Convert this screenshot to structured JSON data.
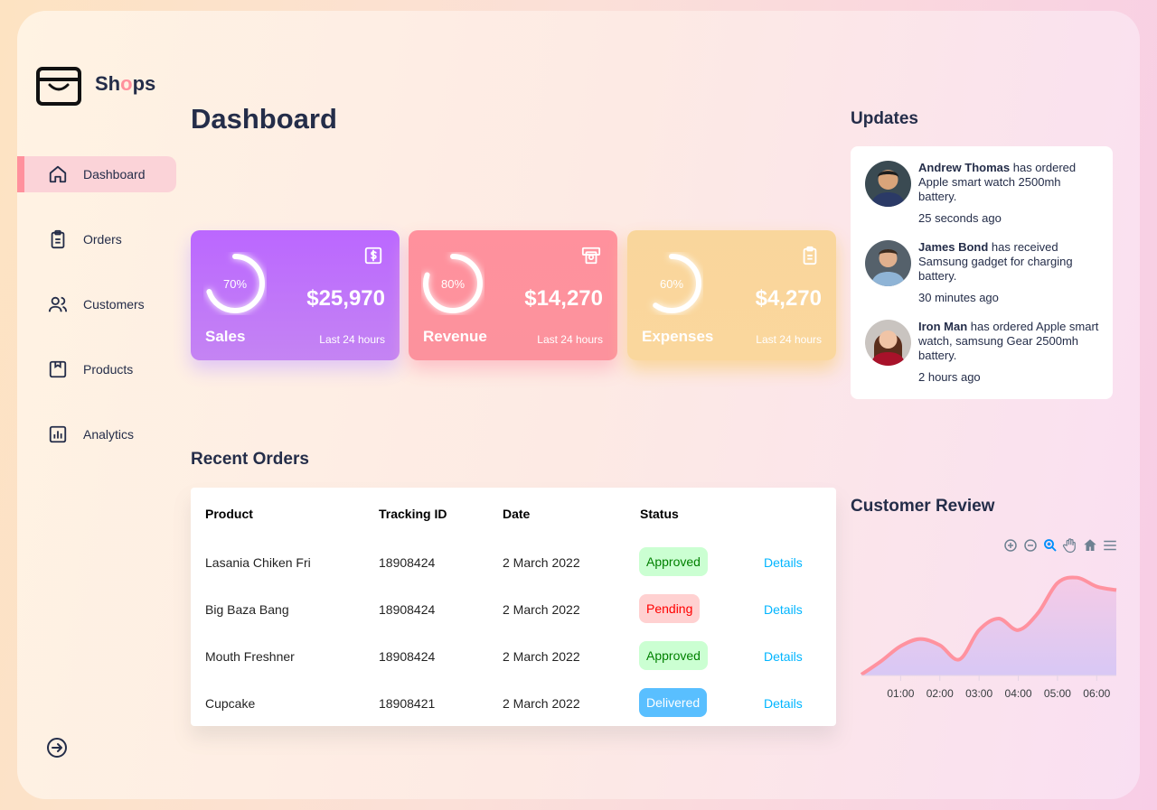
{
  "brand": {
    "name_pre": "Sh",
    "name_o": "o",
    "name_post": "ps"
  },
  "sidebar": {
    "items": [
      {
        "label": "Dashboard",
        "icon": "home-icon",
        "active": true
      },
      {
        "label": "Orders",
        "icon": "clipboard-icon"
      },
      {
        "label": "Customers",
        "icon": "users-icon"
      },
      {
        "label": "Products",
        "icon": "package-icon"
      },
      {
        "label": "Analytics",
        "icon": "bar-chart-icon"
      }
    ],
    "signout_icon": "sign-out-icon"
  },
  "main": {
    "title": "Dashboard"
  },
  "cards": [
    {
      "title": "Sales",
      "value": "$25,970",
      "percent": "70%",
      "fraction": 0.7,
      "period": "Last 24 hours",
      "icon": "dollar-icon",
      "color": "#bb67ff"
    },
    {
      "title": "Revenue",
      "value": "$14,270",
      "percent": "80%",
      "fraction": 0.8,
      "period": "Last 24 hours",
      "icon": "money-icon",
      "color": "#ff919d"
    },
    {
      "title": "Expenses",
      "value": "$4,270",
      "percent": "60%",
      "fraction": 0.6,
      "period": "Last 24 hours",
      "icon": "clipboard-icon",
      "color": "#fad79d"
    }
  ],
  "orders": {
    "title": "Recent Orders",
    "headers": [
      "Product",
      "Tracking ID",
      "Date",
      "Status"
    ],
    "rows": [
      {
        "product": "Lasania Chiken Fri",
        "tracking": "18908424",
        "date": "2 March 2022",
        "status": "Approved",
        "status_type": "approved",
        "action": "Details"
      },
      {
        "product": "Big Baza Bang",
        "tracking": "18908424",
        "date": "2 March 2022",
        "status": "Pending",
        "status_type": "pending",
        "action": "Details"
      },
      {
        "product": "Mouth Freshner",
        "tracking": "18908424",
        "date": "2 March 2022",
        "status": "Approved",
        "status_type": "approved",
        "action": "Details"
      },
      {
        "product": "Cupcake",
        "tracking": "18908421",
        "date": "2 March 2022",
        "status": "Delivered",
        "status_type": "delivered",
        "action": "Details"
      }
    ]
  },
  "updates": {
    "title": "Updates",
    "items": [
      {
        "name": "Andrew Thomas",
        "text": " has ordered Apple smart watch 2500mh battery.",
        "time": "25 seconds ago"
      },
      {
        "name": "James Bond",
        "text": " has received Samsung gadget for charging battery.",
        "time": "30 minutes ago"
      },
      {
        "name": "Iron Man",
        "text": " has ordered Apple smart watch, samsung Gear 2500mh battery.",
        "time": "2 hours ago"
      }
    ]
  },
  "review": {
    "title": "Customer Review",
    "toolbar": [
      "zoom-in-icon",
      "zoom-out-icon",
      "magnifier-icon",
      "pan-hand-icon",
      "home-reset-icon",
      "menu-icon"
    ]
  },
  "chart_data": {
    "type": "area",
    "x": [
      "00:00",
      "00:30",
      "01:00",
      "01:30",
      "02:00",
      "02:30",
      "03:00",
      "03:30",
      "04:00",
      "04:30",
      "05:00",
      "05:30",
      "06:00",
      "06:30"
    ],
    "tick_labels": [
      "01:00",
      "02:00",
      "03:00",
      "04:00",
      "05:00",
      "06:00"
    ],
    "series": [
      {
        "values": [
          1,
          16,
          33,
          41,
          34,
          18,
          51,
          64,
          51,
          70,
          104,
          110,
          100,
          96
        ]
      }
    ],
    "ylim": [
      0,
      130
    ],
    "grid": false,
    "line_color": "#ff929f",
    "fill_color": "#d8c8f5"
  }
}
